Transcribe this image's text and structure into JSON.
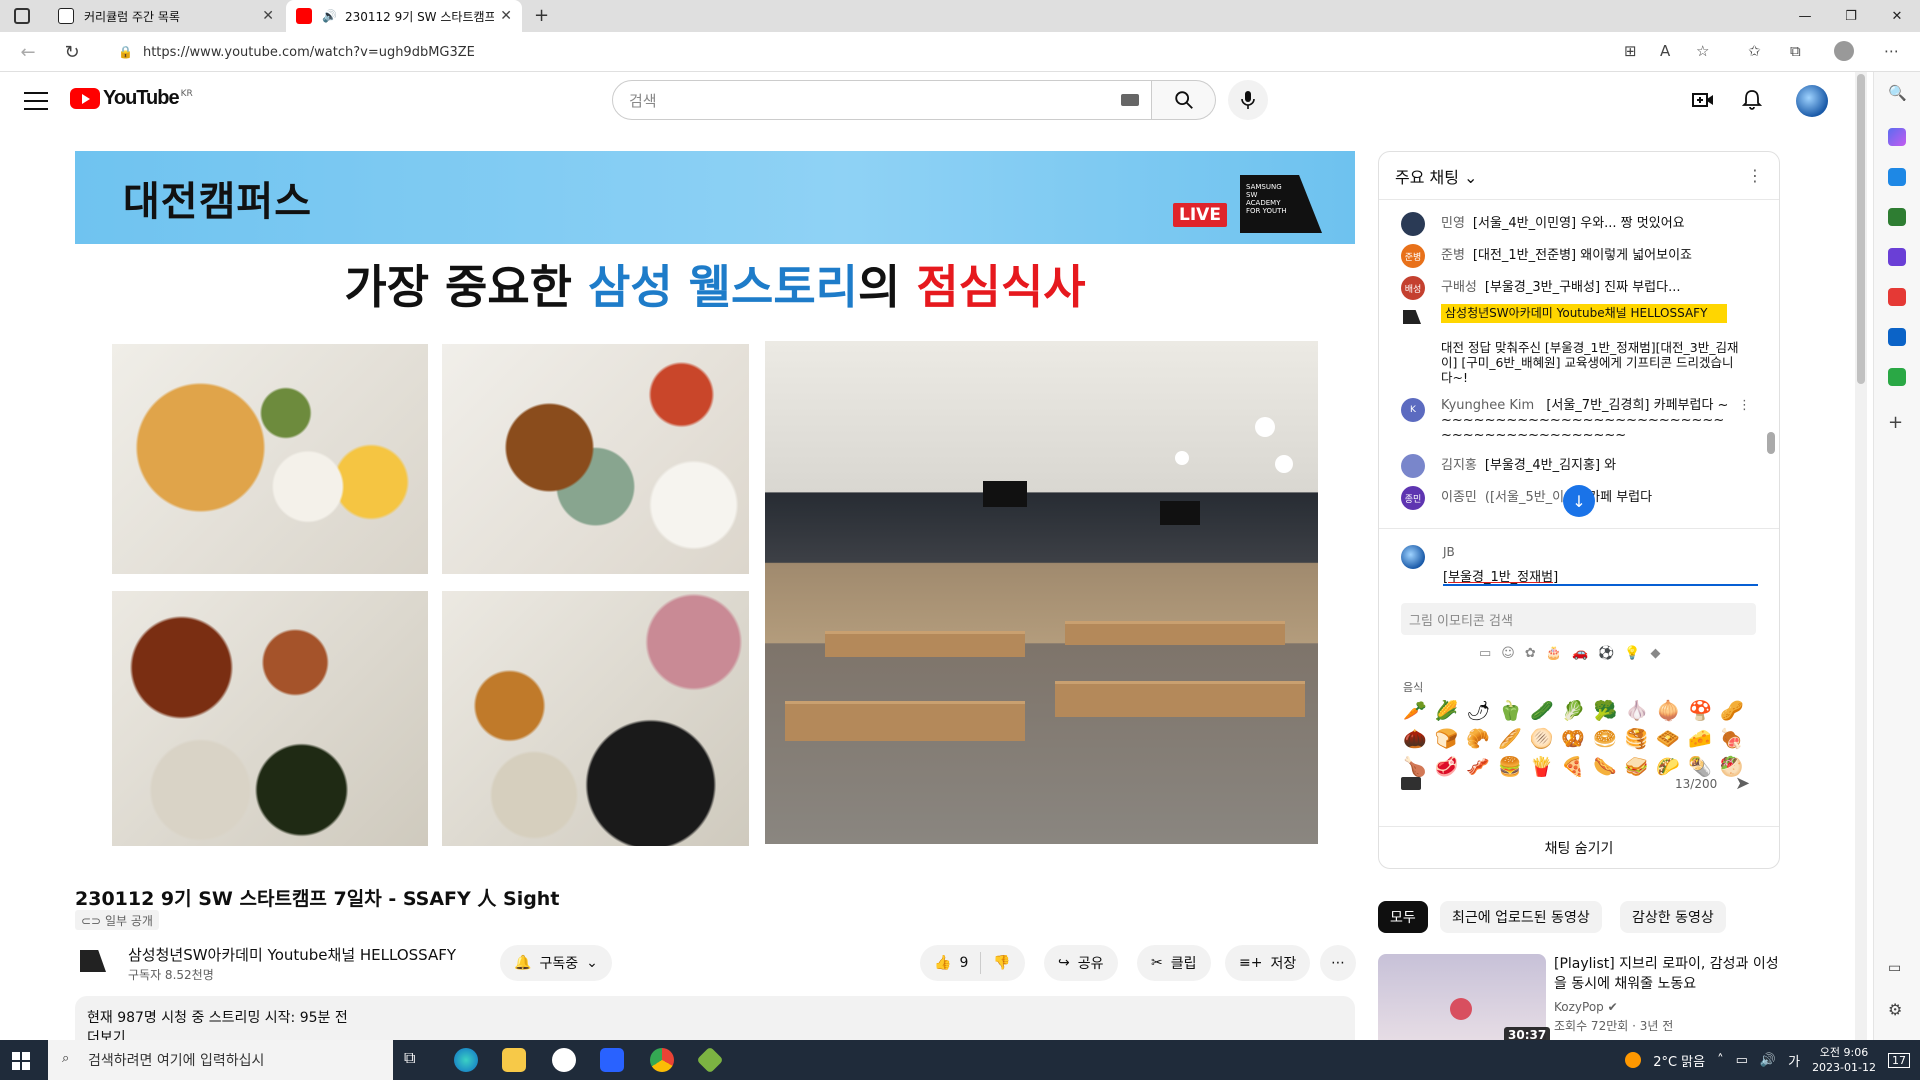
{
  "browser": {
    "tabs": [
      {
        "title": "커리큘럼 주간 목록"
      },
      {
        "title": "230112 9기 SW 스타트캠프"
      }
    ],
    "url": "https://www.youtube.com/watch?v=ugh9dbMG3ZE"
  },
  "youtube": {
    "logo_text": "YouTube",
    "region": "KR",
    "search_placeholder": "검색"
  },
  "video": {
    "banner_title": "대전캠퍼스",
    "live_label": "LIVE",
    "academy_logo": "SAMSUNG SW ACADEMY FOR YOUTH",
    "headline_part1": "가장 중요한 ",
    "headline_part2": "삼성 웰스토리",
    "headline_part3": "의 ",
    "headline_part4": "점심식사",
    "title": "230112 9기 SW 스타트캠프 7일차 - SSAFY 人 Sight",
    "privacy": "일부 공개",
    "channel_name": "삼성청년SW아카데미 Youtube채널 HELLOSSAFY",
    "subscribers": "구독자 8.52천명",
    "subscribe_label": "구독중",
    "like_count": "9",
    "share_label": "공유",
    "clip_label": "클립",
    "save_label": "저장",
    "description_line1": "현재 987명 시청 중 스트리밍 시작: 95분 전",
    "description_more": "더보기"
  },
  "chat": {
    "header": "주요 채팅",
    "messages": [
      {
        "author": "민영",
        "text": "[서울_4반_이민영] 우와... 짱 멋있어요",
        "avatar_color": "#2a3a55",
        "initials": ""
      },
      {
        "author": "준병",
        "text": "[대전_1반_전준병] 왜이렇게 넓어보이죠",
        "avatar_color": "#e8711a",
        "initials": "준병"
      },
      {
        "author": "구배성",
        "text": "[부울경_3반_구배성] 진짜 부럽다...",
        "avatar_color": "#c4402f",
        "initials": "배성"
      },
      {
        "author": "Kyunghee Kim",
        "text": "[서울_7반_김경희] 카페부럽다 ~~~~~~~~~~~~~~~~~~~~~~~~~~~~~~~~~~~~~~~~~~~~",
        "avatar_color": "#5c6bc0",
        "initials": "K"
      },
      {
        "author": "김지홍",
        "text": "[부울경_4반_김지홍] 와",
        "avatar_color": "#7986cb",
        "initials": ""
      },
      {
        "author": "이종민",
        "text": "([서울_5반_이",
        "text2": "카페 부럽다",
        "avatar_color": "#5e35b1",
        "initials": "종민"
      }
    ],
    "moderator_author": "삼성청년SW아카데미 Youtube채널 HELLOSSAFY",
    "moderator_text": "대전 정답 맞춰주신 [부울경_1반_정재범][대전_3반_김재이] [구미_6반_배혜원] 교육생에게 기프티콘 드리겠습니다~!",
    "my_name": "JB",
    "input_value": "[부울경_1반_정재범]",
    "emoji_search_placeholder": "그림 이모티콘 검색",
    "emoji_category": "음식",
    "emoji_rows": [
      [
        "🥕",
        "🌽",
        "🌶",
        "🫑",
        "🥒",
        "🥬",
        "🥦",
        "🧄",
        "🧅",
        "🍄",
        "🥜"
      ],
      [
        "🌰",
        "🍞",
        "🥐",
        "🥖",
        "🫓",
        "🥨",
        "🥯",
        "🥞",
        "🧇",
        "🧀",
        "🍖"
      ],
      [
        "🍗",
        "🥩",
        "🥓",
        "🍔",
        "🍟",
        "🍕",
        "🌭",
        "🥪",
        "🌮",
        "🌯",
        "🥙"
      ]
    ],
    "char_count": "13/200",
    "hide_label": "채팅 숨기기"
  },
  "recommendations": {
    "chips": [
      "모두",
      "최근에 업로드된 동영상",
      "감상한 동영상"
    ],
    "item": {
      "title": "[Playlist] 지브리 로파이, 감성과 이성을 동시에 채워줄 노동요",
      "channel": "KozyPop",
      "meta": "조회수 72만회 · 3년 전",
      "duration": "30:37"
    }
  },
  "taskbar": {
    "search_placeholder": "검색하려면 여기에 입력하십시",
    "weather": "2°C 맑음",
    "ime": "가",
    "time": "오전 9:06",
    "date": "2023-01-12",
    "notifications": "17"
  }
}
